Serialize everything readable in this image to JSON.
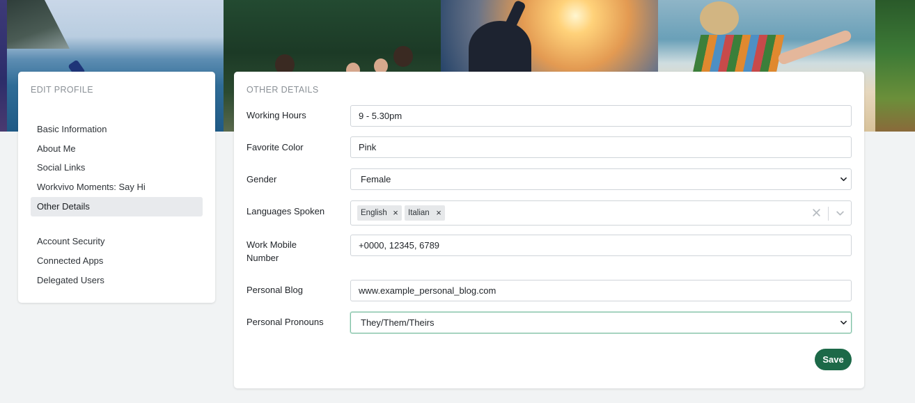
{
  "sidebar": {
    "heading": "EDIT PROFILE",
    "items": [
      {
        "label": "Basic Information",
        "active": false
      },
      {
        "label": "About Me",
        "active": false
      },
      {
        "label": "Social Links",
        "active": false
      },
      {
        "label": "Workvivo Moments: Say Hi",
        "active": false
      },
      {
        "label": "Other Details",
        "active": true
      },
      {
        "label": "Account Security",
        "active": false
      },
      {
        "label": "Connected Apps",
        "active": false
      },
      {
        "label": "Delegated Users",
        "active": false
      }
    ]
  },
  "main": {
    "heading": "OTHER DETAILS",
    "fields": {
      "working_hours": {
        "label": "Working Hours",
        "value": "9 - 5.30pm"
      },
      "favorite_color": {
        "label": "Favorite Color",
        "value": "Pink"
      },
      "gender": {
        "label": "Gender",
        "selected": "Female"
      },
      "languages": {
        "label": "Languages Spoken",
        "tags": [
          "English",
          "Italian"
        ]
      },
      "work_mobile": {
        "label": "Work Mobile Number",
        "value": "+0000, 12345, 6789"
      },
      "personal_blog": {
        "label": "Personal Blog",
        "value": "www.example_personal_blog.com"
      },
      "pronouns": {
        "label": "Personal Pronouns",
        "selected": "They/Them/Theirs"
      }
    },
    "save_label": "Save"
  },
  "colors": {
    "accent": "#1c6948",
    "focus_border": "#7dbfa3",
    "page_background": "#f1f3f4",
    "active_nav_background": "#e8eaed"
  },
  "icons": [
    "chevron-down-icon",
    "close-icon",
    "clear-icon"
  ]
}
